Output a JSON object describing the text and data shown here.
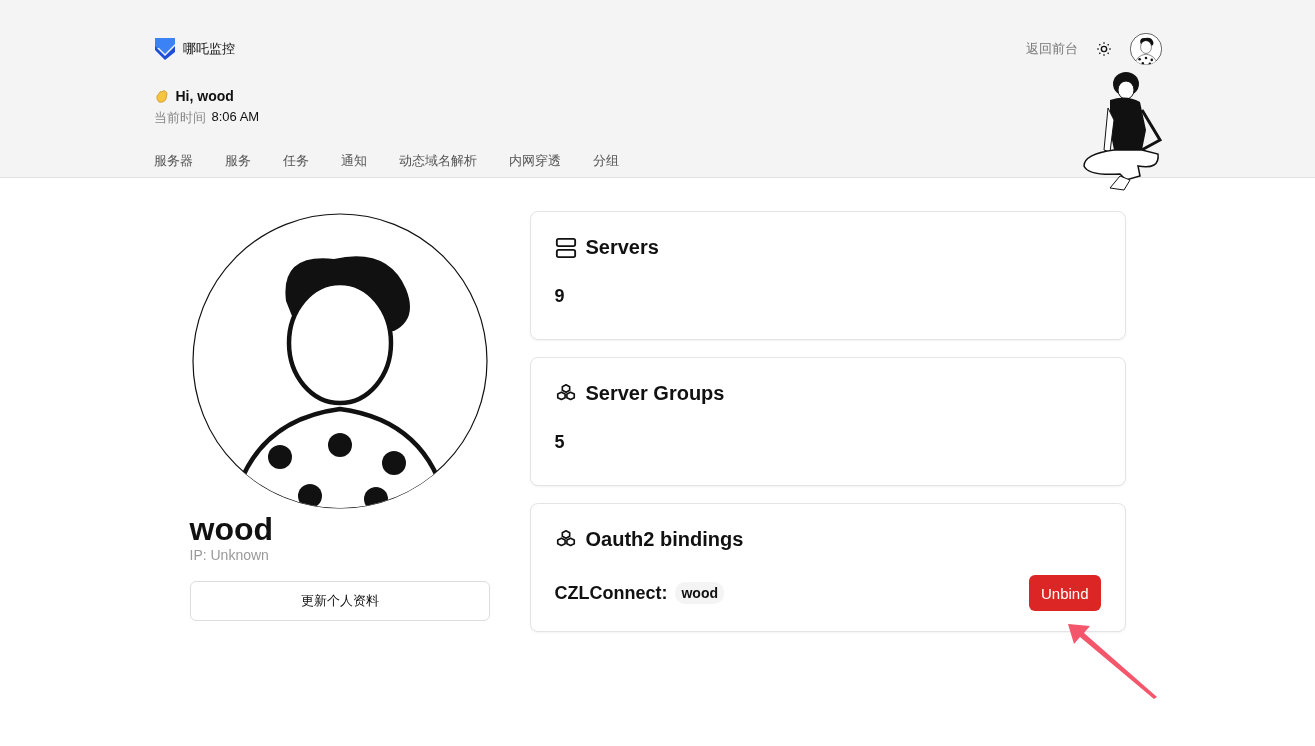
{
  "brand": {
    "name": "哪吒监控"
  },
  "header": {
    "back_link": "返回前台"
  },
  "greeting": {
    "text": "Hi, wood",
    "time_label": "当前时间",
    "time": "8:06 AM"
  },
  "nav": [
    {
      "label": "服务器"
    },
    {
      "label": "服务"
    },
    {
      "label": "任务"
    },
    {
      "label": "通知"
    },
    {
      "label": "动态域名解析"
    },
    {
      "label": "内网穿透"
    },
    {
      "label": "分组"
    }
  ],
  "profile": {
    "username": "wood",
    "ip": "IP: Unknown",
    "update_button": "更新个人资料"
  },
  "cards": [
    {
      "kind": "stat",
      "title": "Servers",
      "value": "9"
    },
    {
      "kind": "stat",
      "title": "Server Groups",
      "value": "5"
    },
    {
      "kind": "bindings",
      "title": "Oauth2 bindings",
      "bindings": [
        {
          "provider": "CZLConnect:",
          "account": "wood",
          "button": "Unbind"
        }
      ]
    }
  ]
}
